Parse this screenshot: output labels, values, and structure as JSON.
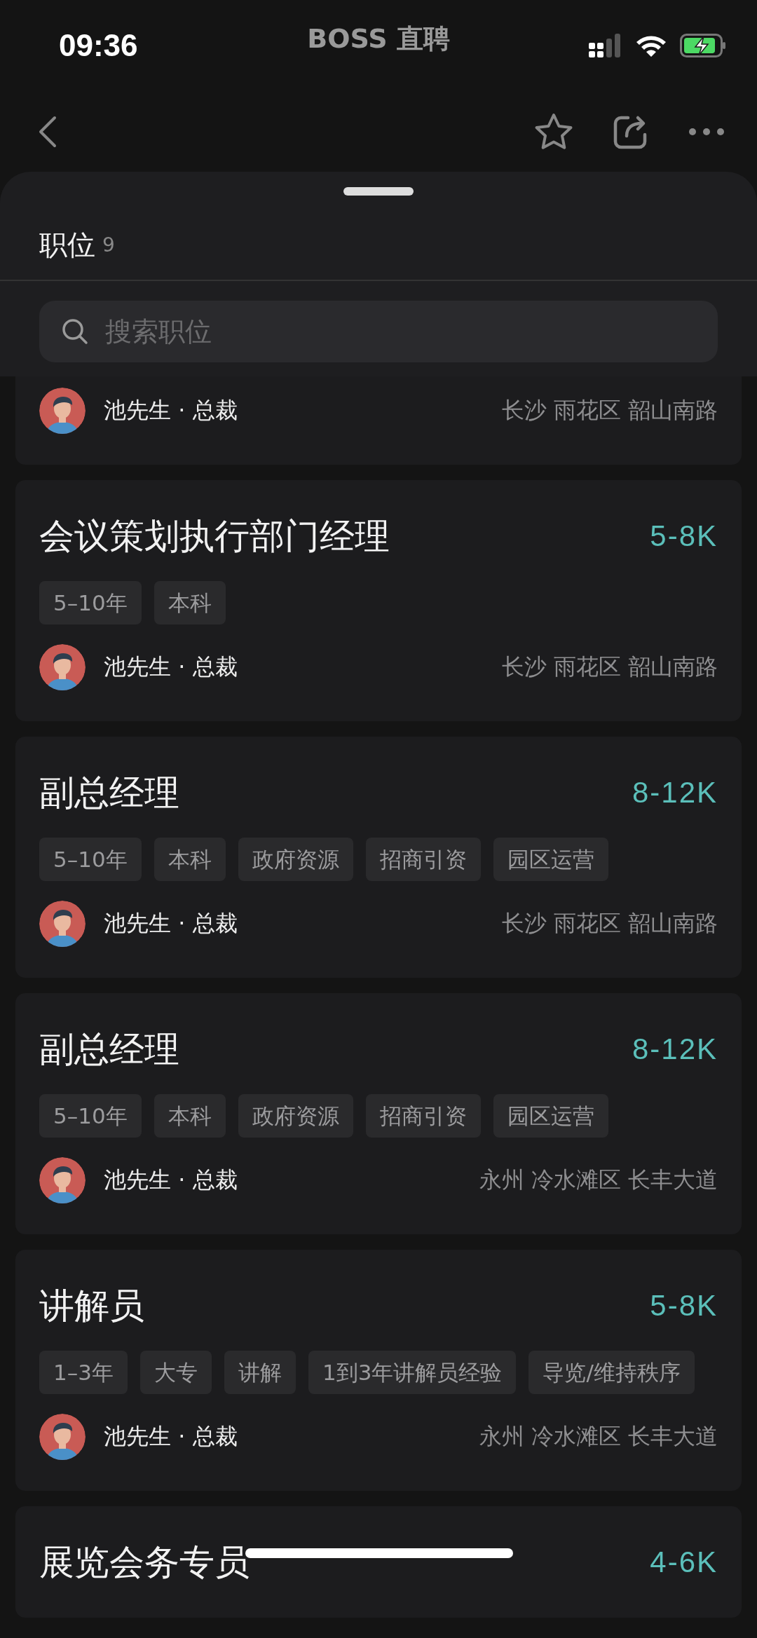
{
  "status_bar": {
    "time": "09:36",
    "app_label": "BOSS 直聘"
  },
  "sheet": {
    "title": "职位",
    "count": "9",
    "search": {
      "placeholder": "搜索职位"
    }
  },
  "jobs": [
    {
      "recruiter": "池先生 · 总裁",
      "location": "长沙 雨花区 韶山南路"
    },
    {
      "title": "会议策划执行部门经理",
      "salary": "5-8K",
      "tags": [
        "5–10年",
        "本科"
      ],
      "recruiter": "池先生 · 总裁",
      "location": "长沙 雨花区 韶山南路"
    },
    {
      "title": "副总经理",
      "salary": "8-12K",
      "tags": [
        "5–10年",
        "本科",
        "政府资源",
        "招商引资",
        "园区运营"
      ],
      "recruiter": "池先生 · 总裁",
      "location": "长沙 雨花区 韶山南路"
    },
    {
      "title": "副总经理",
      "salary": "8-12K",
      "tags": [
        "5–10年",
        "本科",
        "政府资源",
        "招商引资",
        "园区运营"
      ],
      "recruiter": "池先生 · 总裁",
      "location": "永州 冷水滩区 长丰大道"
    },
    {
      "title": "讲解员",
      "salary": "5-8K",
      "tags": [
        "1–3年",
        "大专",
        "讲解",
        "1到3年讲解员经验",
        "导览/维持秩序"
      ],
      "recruiter": "池先生 · 总裁",
      "location": "永州 冷水滩区 长丰大道"
    },
    {
      "title": "展览会务专员",
      "salary": "4-6K"
    }
  ]
}
